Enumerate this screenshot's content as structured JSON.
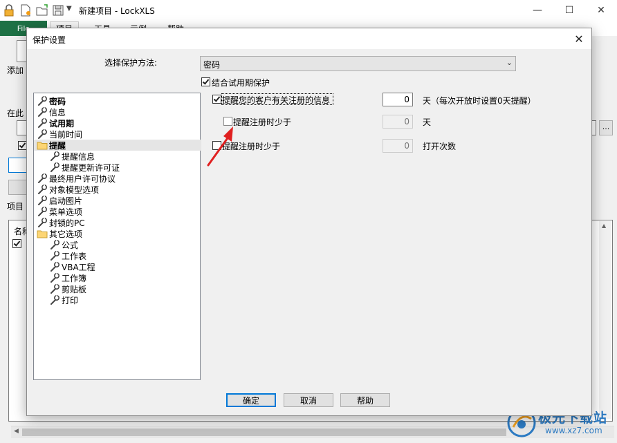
{
  "app": {
    "title": "新建项目 - LockXLS",
    "minimize_glyph": "—",
    "maximize_glyph": "☐",
    "close_glyph": "✕",
    "tabs": [
      {
        "label": "File"
      },
      {
        "label": "项目"
      },
      {
        "label": "工具"
      },
      {
        "label": "示例"
      },
      {
        "label": "帮助"
      }
    ],
    "bg_labels": {
      "add": "添加",
      "in_this": "在此",
      "items": "项目",
      "name": "名称",
      "ellipsis": "..."
    }
  },
  "dialog": {
    "title": "保护设置",
    "close_glyph": "✕",
    "method_label": "选择保护方法:",
    "method_value": "密码",
    "combine_trial_label": "结合试用期保护",
    "combine_trial_checked": true,
    "tree": [
      {
        "label": "密码",
        "icon": "wrench-icon",
        "bold": true
      },
      {
        "label": "信息",
        "icon": "wrench-icon",
        "bold": false
      },
      {
        "label": "试用期",
        "icon": "wrench-icon",
        "bold": true
      },
      {
        "label": "当前时间",
        "icon": "wrench-icon",
        "bold": false
      },
      {
        "label": "提醒",
        "icon": "folder-icon",
        "bold": true,
        "selected": true
      },
      {
        "label": "提醒信息",
        "icon": "wrench-icon",
        "bold": false
      },
      {
        "label": "提醒更新许可证",
        "icon": "wrench-icon",
        "bold": false
      },
      {
        "label": "最终用户许可协议",
        "icon": "wrench-icon",
        "bold": false
      },
      {
        "label": "对象模型选项",
        "icon": "wrench-icon",
        "bold": false
      },
      {
        "label": "启动图片",
        "icon": "wrench-icon",
        "bold": false
      },
      {
        "label": "菜单选项",
        "icon": "wrench-icon",
        "bold": false
      },
      {
        "label": "封锁的PC",
        "icon": "wrench-icon",
        "bold": false
      },
      {
        "label": "其它选项",
        "icon": "folder-icon",
        "bold": false
      },
      {
        "label": "公式",
        "icon": "wrench-icon",
        "bold": false
      },
      {
        "label": "工作表",
        "icon": "wrench-icon",
        "bold": false
      },
      {
        "label": "VBA工程",
        "icon": "wrench-icon",
        "bold": false
      },
      {
        "label": "工作簿",
        "icon": "wrench-icon",
        "bold": false
      },
      {
        "label": "剪贴板",
        "icon": "wrench-icon",
        "bold": false
      },
      {
        "label": "打印",
        "icon": "wrench-icon",
        "bold": false
      }
    ],
    "remind_register": {
      "label": "提醒您的客户有关注册的信息",
      "checked": true,
      "value": "0",
      "unit": "天（每次开放时设置0天提醒）"
    },
    "remind_days": {
      "label": "提醒注册时少于",
      "checked": false,
      "value": "0",
      "unit": "天"
    },
    "remind_runs": {
      "label": "提醒注册时少于",
      "checked": false,
      "value": "0",
      "unit": "打开次数"
    },
    "buttons": {
      "ok": "确定",
      "cancel": "取消",
      "help": "帮助"
    }
  },
  "watermark": {
    "text": "极光下载站",
    "url": "www.xz7.com"
  },
  "colors": {
    "file_tab": "#1e7145",
    "arrow": "#e02020",
    "default_button_border": "#0078d7",
    "watermark": "#2d7bc3"
  }
}
